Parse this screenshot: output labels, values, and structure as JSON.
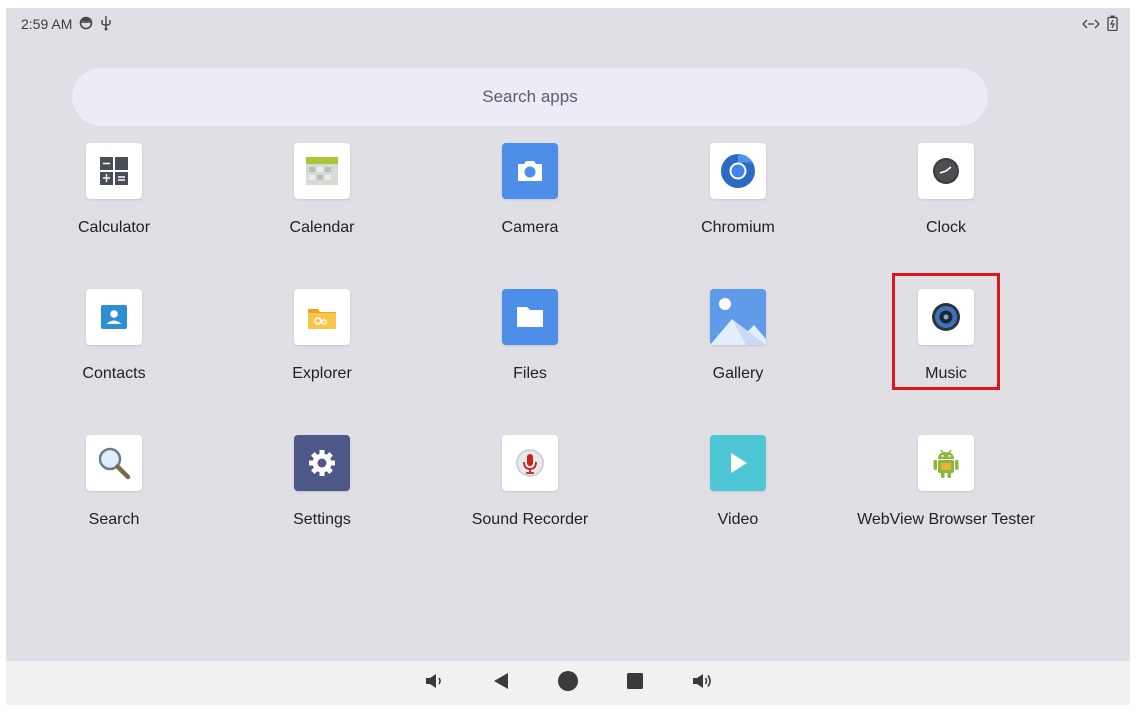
{
  "status_bar": {
    "time": "2:59 AM",
    "left_icons": [
      "sync-icon",
      "usb-icon"
    ],
    "right_icons": [
      "data-transfer-icon",
      "battery-icon"
    ]
  },
  "search": {
    "placeholder": "Search apps"
  },
  "apps": [
    {
      "label": "Calculator",
      "icon": "calculator-icon"
    },
    {
      "label": "Calendar",
      "icon": "calendar-icon"
    },
    {
      "label": "Camera",
      "icon": "camera-icon"
    },
    {
      "label": "Chromium",
      "icon": "chromium-icon"
    },
    {
      "label": "Clock",
      "icon": "clock-icon"
    },
    {
      "label": "Contacts",
      "icon": "contacts-icon"
    },
    {
      "label": "Explorer",
      "icon": "explorer-icon"
    },
    {
      "label": "Files",
      "icon": "folder-icon"
    },
    {
      "label": "Gallery",
      "icon": "gallery-icon"
    },
    {
      "label": "Music",
      "icon": "music-speaker-icon",
      "highlighted": true
    },
    {
      "label": "Search",
      "icon": "magnifier-icon"
    },
    {
      "label": "Settings",
      "icon": "gear-icon"
    },
    {
      "label": "Sound Recorder",
      "icon": "microphone-icon"
    },
    {
      "label": "Video",
      "icon": "play-icon"
    },
    {
      "label": "WebView Browser Tester",
      "icon": "android-icon"
    }
  ],
  "highlight_color": "#e01515",
  "nav_bar": {
    "buttons": [
      "volume-down-icon",
      "back-icon",
      "home-icon",
      "recents-icon",
      "volume-up-icon"
    ]
  }
}
